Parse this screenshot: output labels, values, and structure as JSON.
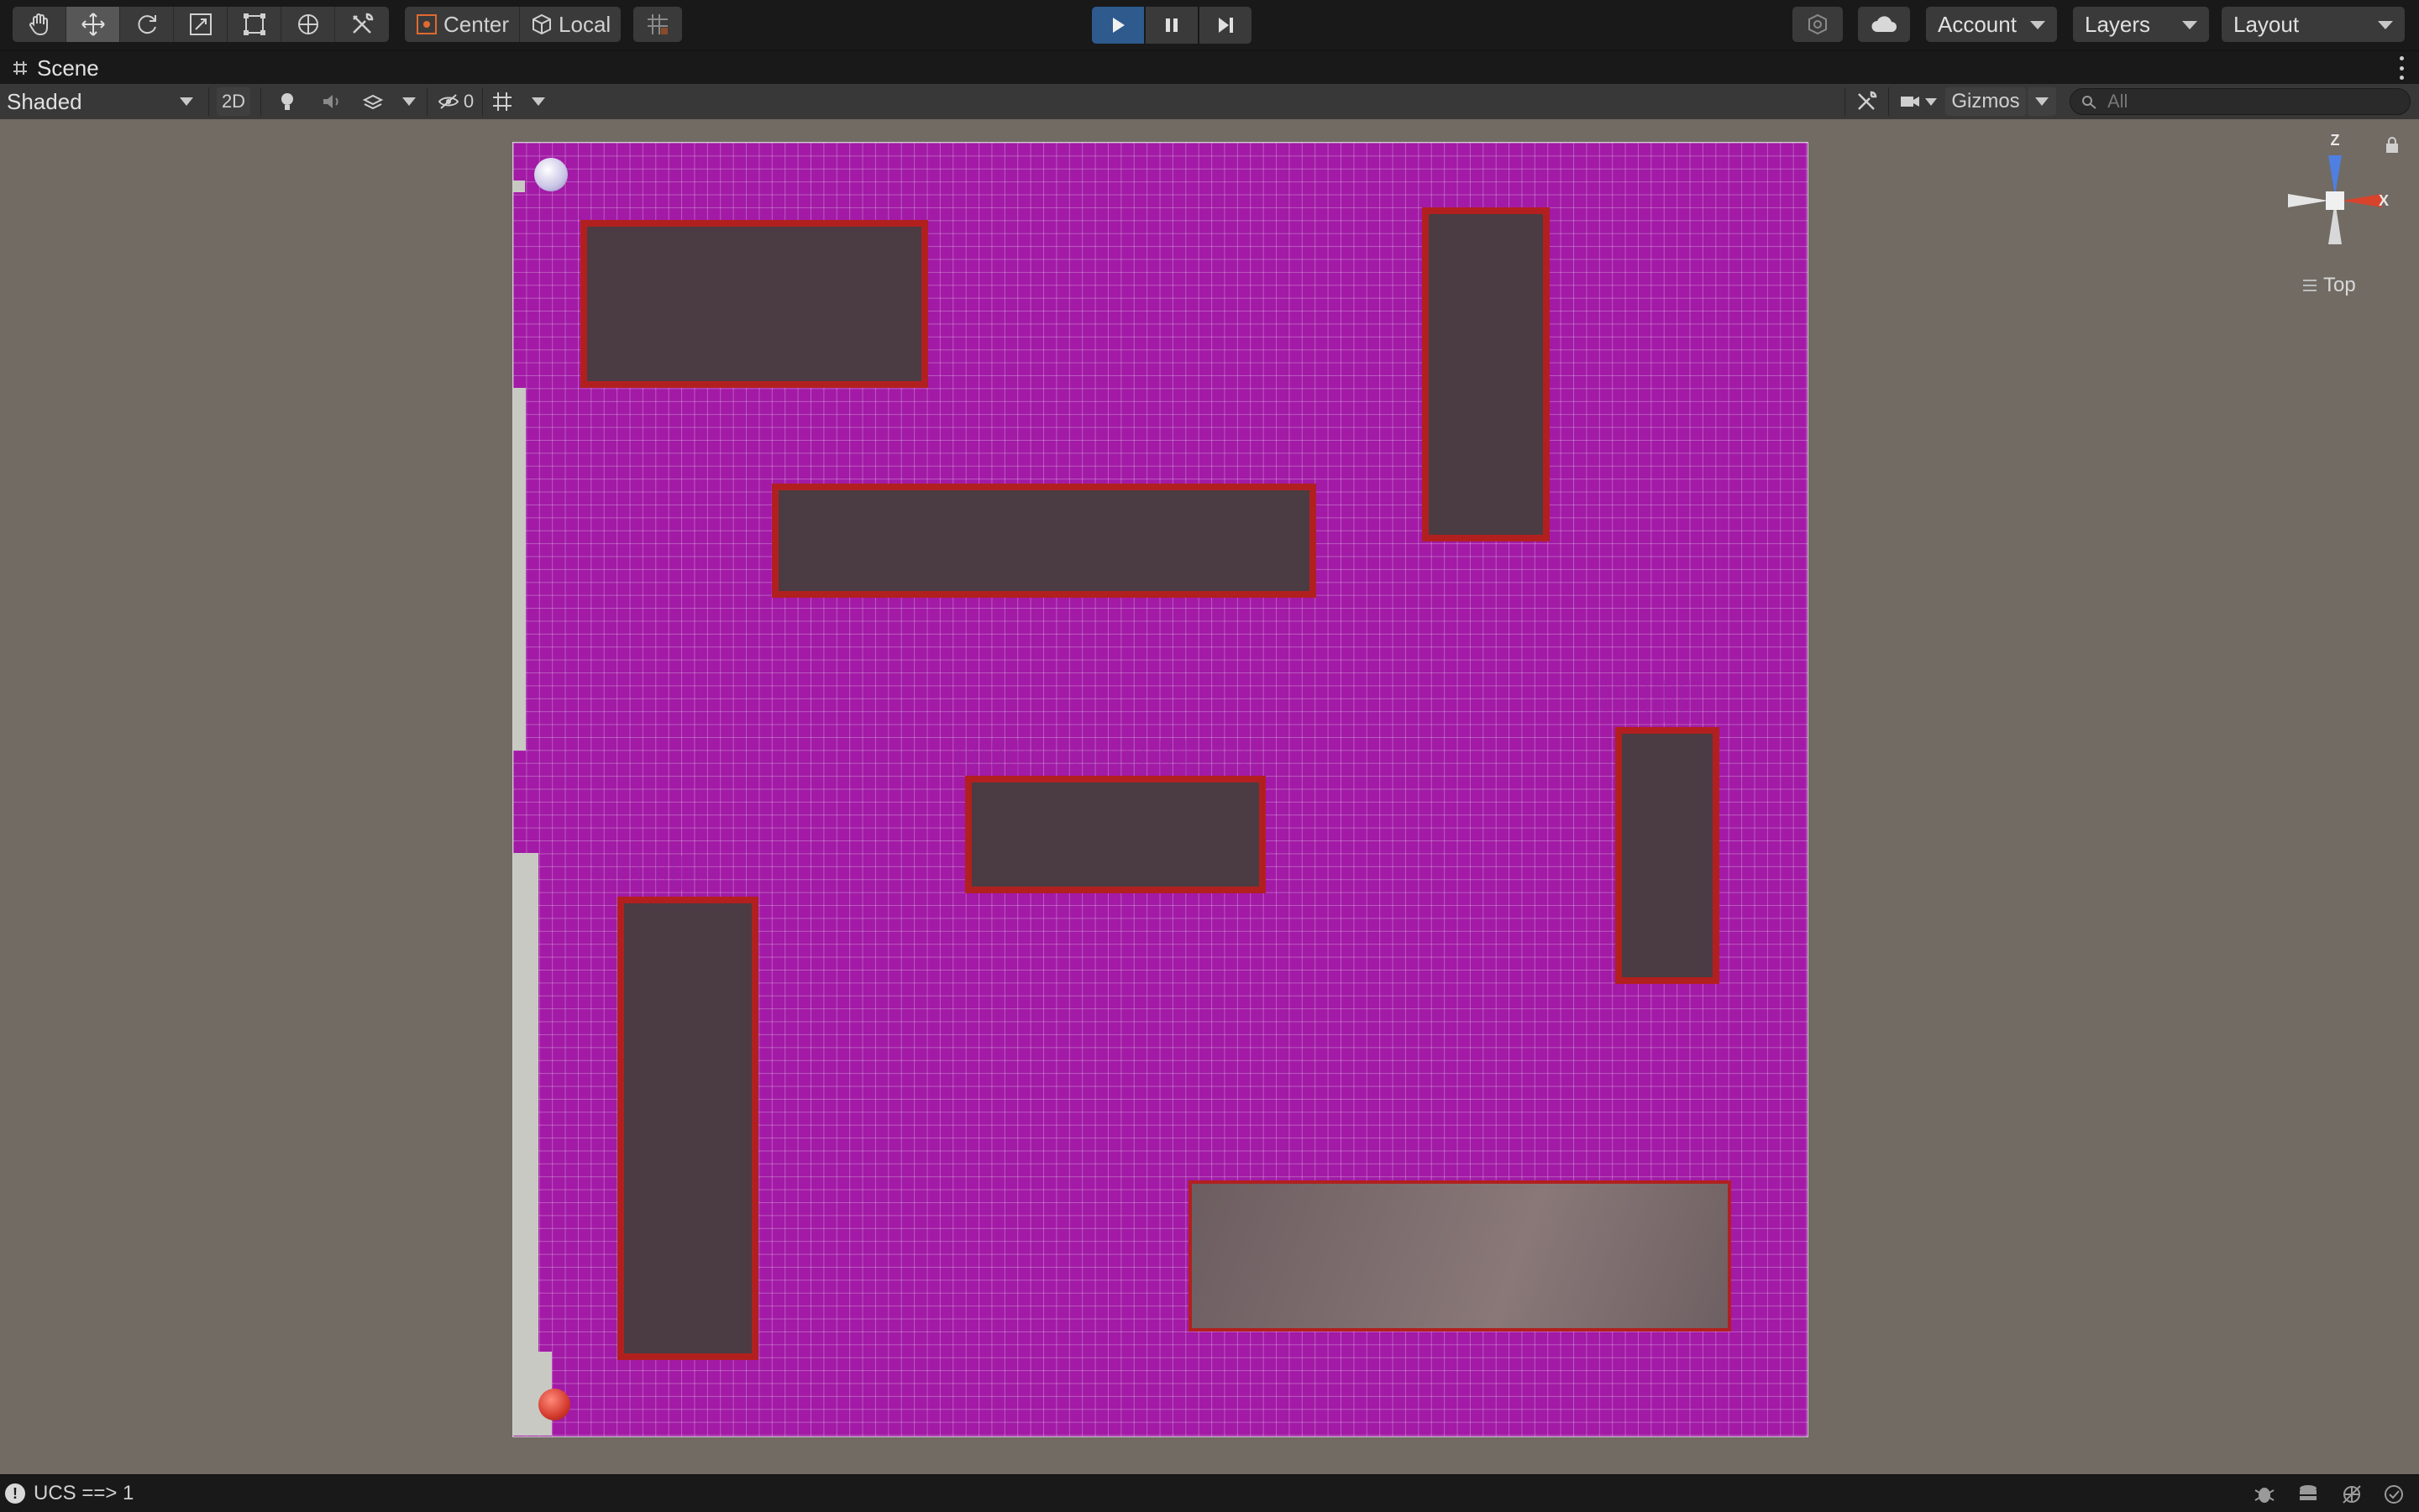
{
  "toolbar": {
    "tools": [
      {
        "name": "hand-tool",
        "icon": "hand-icon"
      },
      {
        "name": "move-tool",
        "icon": "move-icon"
      },
      {
        "name": "rotate-tool",
        "icon": "rotate-icon"
      },
      {
        "name": "scale-tool",
        "icon": "scale-icon"
      },
      {
        "name": "rect-tool",
        "icon": "rect-icon"
      },
      {
        "name": "transform-tool",
        "icon": "transform-icon"
      },
      {
        "name": "custom-tool",
        "icon": "tools-icon"
      }
    ],
    "active_tool": "move-tool",
    "pivot_mode": "Center",
    "pivot_rotation": "Local",
    "play_controls": [
      "play",
      "pause",
      "step"
    ],
    "account_label": "Account",
    "layers_label": "Layers",
    "layout_label": "Layout"
  },
  "tab": {
    "title": "Scene"
  },
  "scene_toolbar": {
    "shading_mode": "Shaded",
    "mode_2d_label": "2D",
    "hidden_count": "0",
    "gizmos_label": "Gizmos",
    "search_placeholder": "All"
  },
  "gizmo": {
    "axis_z": "Z",
    "axis_x": "X",
    "view_label": "Top"
  },
  "status": {
    "message": "UCS ==> 1"
  },
  "colors": {
    "ground": "#a21aa6",
    "wall_fill": "#4a3c42",
    "wall_border": "#b1201f",
    "play_active": "#2e5a8e"
  }
}
